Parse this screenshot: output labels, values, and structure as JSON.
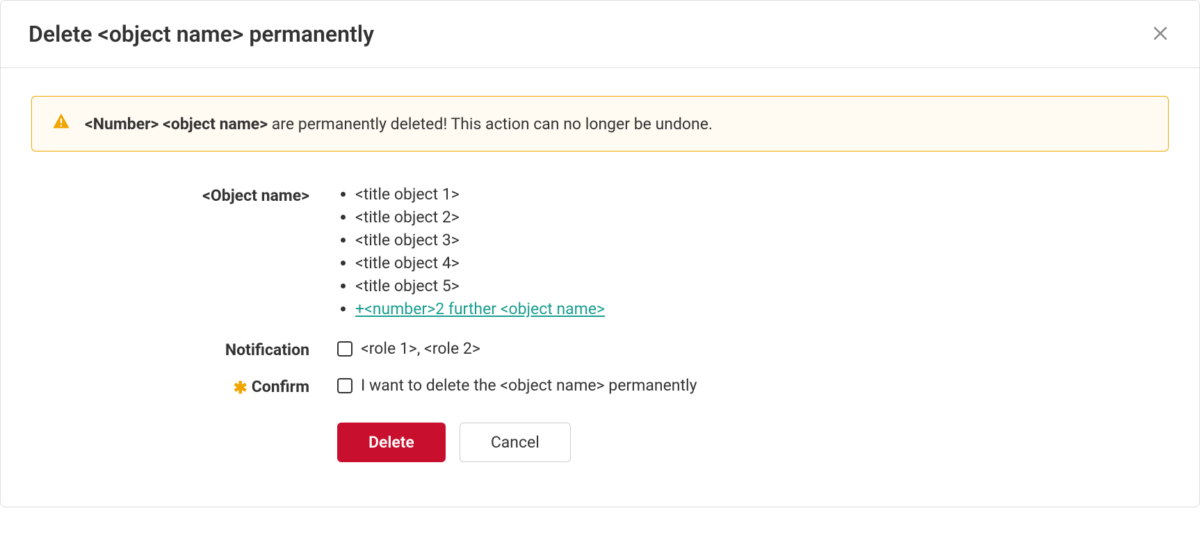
{
  "dialog": {
    "title": "Delete <object name> permanently"
  },
  "alert": {
    "bold": "<Number> <object name>",
    "rest": " are permanently deleted! This action can no longer be undone."
  },
  "labels": {
    "object": "<Object name>",
    "notification": "Notification",
    "confirm": "Confirm"
  },
  "objects": {
    "0": "<title object 1>",
    "1": "<title object 2>",
    "2": "<title object 3>",
    "3": "<title object 4>",
    "4": "<title object 5>",
    "more": "+<number>2 further <object name>"
  },
  "notification": {
    "text": "<role 1>, <role 2>"
  },
  "confirm": {
    "text": "I want to delete the <object name> permanently"
  },
  "buttons": {
    "delete": "Delete",
    "cancel": "Cancel"
  }
}
